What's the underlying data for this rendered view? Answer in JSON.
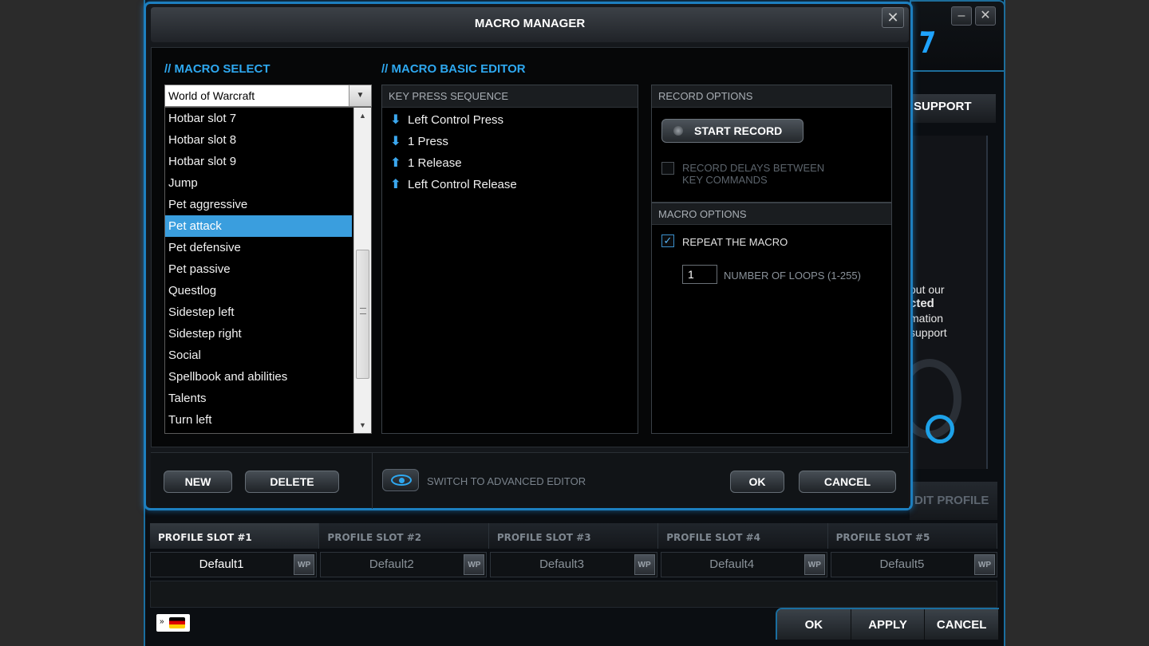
{
  "background": {
    "support_tab": "SUPPORT",
    "support_text": [
      "out our",
      "cted",
      "mation",
      "support"
    ],
    "edit_profile": "DIT PROFILE",
    "profile_tabs": [
      "PROFILE SLOT #1",
      "PROFILE SLOT #2",
      "PROFILE SLOT #3",
      "PROFILE SLOT #4",
      "PROFILE SLOT #5"
    ],
    "profile_names": [
      "Default1",
      "Default2",
      "Default3",
      "Default4",
      "Default5"
    ],
    "wp_label": "WP",
    "flag_prefix": "»",
    "bottom_buttons": {
      "ok": "OK",
      "apply": "APPLY",
      "cancel": "CANCEL"
    },
    "window_buttons": {
      "minimize": "–",
      "close": "✕"
    }
  },
  "dialog": {
    "title": "MACRO MANAGER",
    "close_glyph": "✕",
    "macro_select": {
      "heading": "// MACRO SELECT",
      "game": "World of Warcraft",
      "items": [
        "Hotbar slot 7",
        "Hotbar slot 8",
        "Hotbar slot 9",
        "Jump",
        "Pet aggressive",
        "Pet attack",
        "Pet defensive",
        "Pet passive",
        "Questlog",
        "Sidestep left",
        "Sidestep right",
        "Social",
        "Spellbook and abilities",
        "Talents",
        "Turn left"
      ],
      "selected": "Pet attack"
    },
    "basic_editor": {
      "heading": "// MACRO BASIC EDITOR",
      "sequence_head": "KEY PRESS SEQUENCE",
      "sequence": [
        {
          "label": "Left Control Press",
          "dir": "down"
        },
        {
          "label": "1 Press",
          "dir": "down"
        },
        {
          "label": "1 Release",
          "dir": "up"
        },
        {
          "label": "Left Control Release",
          "dir": "up"
        }
      ]
    },
    "record_options": {
      "head": "RECORD OPTIONS",
      "start_record": "START RECORD",
      "record_delays_line1": "RECORD DELAYS BETWEEN",
      "record_delays_line2": "KEY COMMANDS",
      "record_delays_checked": false
    },
    "macro_options": {
      "head": "MACRO OPTIONS",
      "repeat_label": "REPEAT THE MACRO",
      "repeat_checked": true,
      "loops_value": "1",
      "loops_label": "NUMBER OF LOOPS (1-255)"
    },
    "footer": {
      "new": "NEW",
      "delete": "DELETE",
      "switch_advanced": "SWITCH TO ADVANCED EDITOR",
      "ok": "OK",
      "cancel": "CANCEL"
    }
  },
  "colors": {
    "accent": "#2ea8f0",
    "selection": "#3a9ede",
    "border": "#1d7fbf"
  }
}
